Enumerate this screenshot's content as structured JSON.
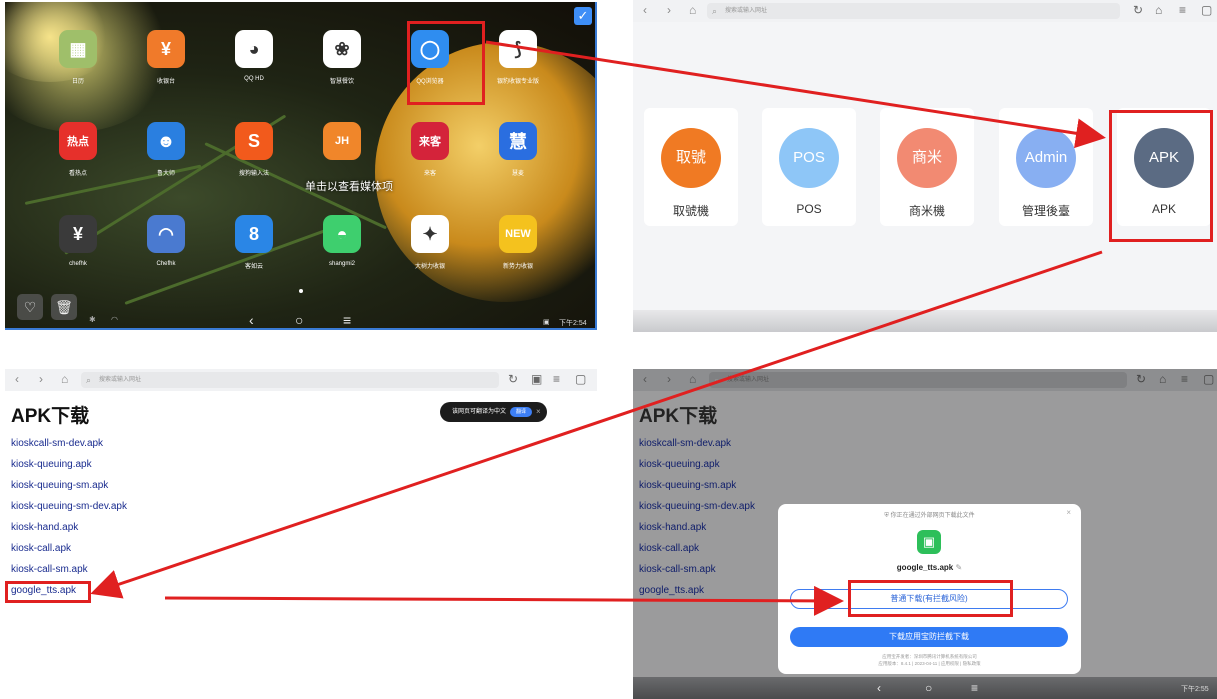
{
  "home": {
    "apps": [
      {
        "label": "日历",
        "icon": "calendar-icon",
        "glyph": "▦",
        "color": "#9fbf6a"
      },
      {
        "label": "收银台",
        "icon": "cashier-icon",
        "glyph": "¥",
        "color": "#f07a2a"
      },
      {
        "label": "QQ HD",
        "icon": "qq-icon",
        "glyph": "◕",
        "color": "#ffffff"
      },
      {
        "label": "智慧餐饮",
        "icon": "smart-dining-icon",
        "glyph": "❀",
        "color": "#ffffff"
      },
      {
        "label": "QQ浏览器",
        "icon": "qq-browser-icon",
        "glyph": "◯",
        "color": "#2f8df0"
      },
      {
        "label": "银豹收银专业版",
        "icon": "leopard-icon",
        "glyph": "⟆",
        "color": "#ffffff"
      },
      {
        "label": "看热点",
        "icon": "hot-news-icon",
        "glyph": "热点",
        "color": "#e6302b"
      },
      {
        "label": "鲁大师",
        "icon": "master-lu-icon",
        "glyph": "☻",
        "color": "#2a7fe0"
      },
      {
        "label": "搜狗输入法",
        "icon": "sogou-icon",
        "glyph": "S",
        "color": "#f25a1c"
      },
      {
        "label": "",
        "icon": "jh-icon",
        "glyph": "JH",
        "color": "#f0862a"
      },
      {
        "label": "来客",
        "icon": "laike-icon",
        "glyph": "来客",
        "color": "#d4233a"
      },
      {
        "label": "慧麦",
        "icon": "huimai-icon",
        "glyph": "慧",
        "color": "#2a6ee0"
      },
      {
        "label": "chefhk",
        "icon": "chefhk-icon",
        "glyph": "¥",
        "color": "#3a3a3a"
      },
      {
        "label": "Chefhk",
        "icon": "chefhk-swirl-icon",
        "glyph": "◠",
        "color": "#4a7ad0"
      },
      {
        "label": "客如云",
        "icon": "keruyun-icon",
        "glyph": "8",
        "color": "#2a86e6"
      },
      {
        "label": "shangmi2",
        "icon": "android-icon",
        "glyph": "◓",
        "color": "#3ecf6e"
      },
      {
        "label": "大树力收银",
        "icon": "dashu-icon",
        "glyph": "✦",
        "color": "#ffffff"
      },
      {
        "label": "新势力收银",
        "icon": "new-power-icon",
        "glyph": "NEW",
        "color": "#f4c21e"
      }
    ],
    "tooltip": "单击以查看媒体项",
    "time": "下午2:54"
  },
  "launcher": {
    "search_placeholder": "搜索或输入网址",
    "cards": [
      {
        "circle": "取號",
        "label": "取號機",
        "color": "#f07a23"
      },
      {
        "circle": "POS",
        "label": "POS",
        "color": "#8ec6f7"
      },
      {
        "circle": "商米",
        "label": "商米機",
        "color": "#f28a72"
      },
      {
        "circle": "Admin",
        "label": "管理後臺",
        "color": "#88aff2"
      },
      {
        "circle": "APK",
        "label": "APK",
        "color": "#5b6b83"
      }
    ]
  },
  "apk_page": {
    "search_placeholder": "搜索或输入网址",
    "title": "APK下载",
    "links": [
      "kioskcall-sm-dev.apk",
      "kiosk-queuing.apk",
      "kiosk-queuing-sm.apk",
      "kiosk-queuing-sm-dev.apk",
      "kiosk-hand.apk",
      "kiosk-call.apk",
      "kiosk-call-sm.apk",
      "google_tts.apk"
    ],
    "translate_prompt": "该网页可翻译为中文",
    "translate_button": "翻译"
  },
  "download_dialog": {
    "warning": "你正在通过外部网页下载此文件",
    "filename": "google_tts.apk",
    "normal_download": "普通下载(有拦截风险)",
    "safe_download": "下载应用宝防拦截下载",
    "footer_line1": "应用宝开发者：深圳市腾讯计算机系统有限公司",
    "footer_line2": "应用版本：8.4.1 | 2023-04-11 | 应用权限 | 隐私政策",
    "time": "下午2:55"
  }
}
